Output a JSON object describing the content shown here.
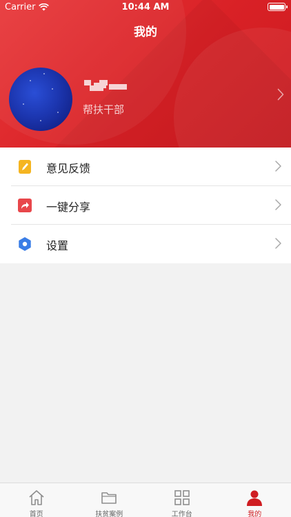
{
  "status_bar": {
    "carrier": "Carrier",
    "time": "10:44 AM"
  },
  "header": {
    "title": "我的",
    "user_role": "帮扶干部"
  },
  "menu": {
    "items": [
      {
        "label": "意见反馈",
        "icon": "feedback-note-icon",
        "icon_color": "#f5b521"
      },
      {
        "label": "一键分享",
        "icon": "share-arrow-icon",
        "icon_color": "#e8474b"
      },
      {
        "label": "设置",
        "icon": "settings-hexagon-icon",
        "icon_color": "#3a7de6"
      }
    ]
  },
  "tabbar": {
    "tabs": [
      {
        "label": "首页",
        "icon": "home-icon",
        "active": false
      },
      {
        "label": "扶贫案例",
        "icon": "folder-icon",
        "active": false
      },
      {
        "label": "工作台",
        "icon": "grid-icon",
        "active": false
      },
      {
        "label": "我的",
        "icon": "user-icon",
        "active": true
      }
    ]
  },
  "colors": {
    "brand_red": "#d92126",
    "active_tab": "#cf1d22",
    "background": "#f2f2f2"
  }
}
